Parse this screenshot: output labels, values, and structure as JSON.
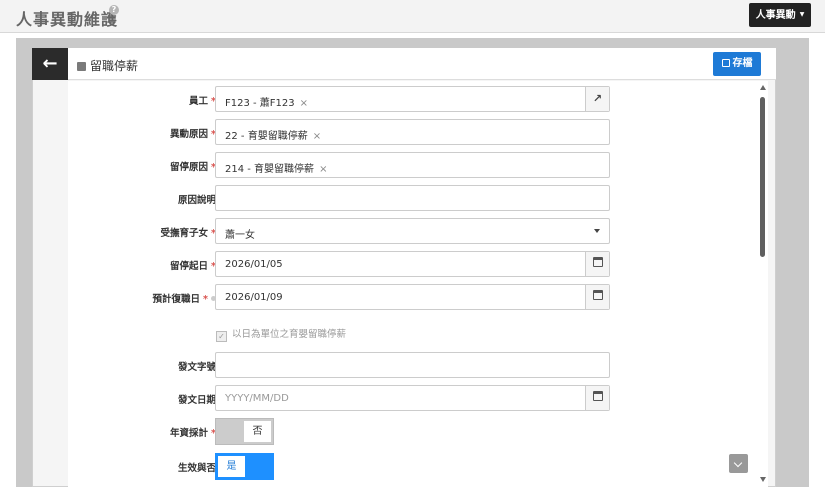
{
  "app": {
    "title": "人事異動維護",
    "help_icon": "?",
    "menu_label": "人事異動"
  },
  "panel": {
    "title": "留職停薪",
    "save_label": "存檔"
  },
  "form": {
    "employee": {
      "label": "員工",
      "value": "F123 - 蕭F123",
      "remove": "×"
    },
    "change_reason": {
      "label": "異動原因",
      "value": "22 - 育嬰留職停薪",
      "remove": "×"
    },
    "suspension_reason": {
      "label": "留停原因",
      "value": "214 - 育嬰留職停薪",
      "remove": "×"
    },
    "reason_note": {
      "label": "原因說明",
      "value": ""
    },
    "child": {
      "label": "受撫育子女",
      "value": "蕭一女"
    },
    "start_date": {
      "label": "留停起日",
      "value": "2026/01/05"
    },
    "return_date": {
      "label": "預計復職日",
      "value": "2026/01/09"
    },
    "daily_unit": {
      "label": "以日為單位之育嬰留職停薪",
      "checked": true
    },
    "doc_number": {
      "label": "發文字號",
      "value": ""
    },
    "doc_date": {
      "label": "發文日期",
      "placeholder": "YYYY/MM/DD"
    },
    "seniority": {
      "label": "年資採計",
      "value": "否"
    },
    "effective": {
      "label": "生效與否",
      "value": "是"
    }
  },
  "colors": {
    "accent": "#1e7ad6",
    "toggle_on": "#1e90ff",
    "required": "#d9534f"
  },
  "icons": {
    "back": "arrow-left-icon",
    "edit": "edit-icon",
    "save": "floppy-disk-icon",
    "open": "external-link-icon",
    "calendar": "calendar-icon",
    "caret": "caret-down-icon"
  }
}
